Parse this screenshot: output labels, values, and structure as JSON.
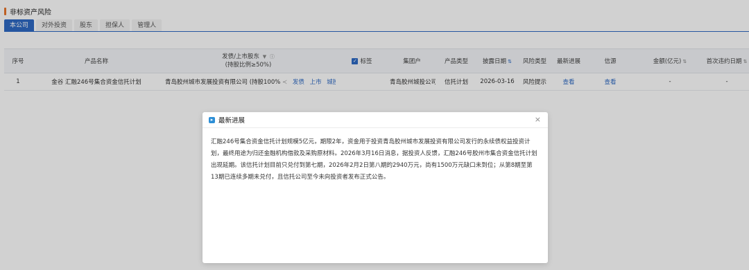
{
  "section": {
    "title": "非标资产风险"
  },
  "tabs": [
    "本公司",
    "对外投资",
    "股东",
    "担保人",
    "管理人"
  ],
  "table": {
    "headers": {
      "seq": "序号",
      "product_name": "产品名称",
      "issuer_line1": "发债/上市股东",
      "issuer_line2": "(持股比例≥50%)",
      "tag": "标签",
      "group": "集团户",
      "product_type": "产品类型",
      "disclose_date": "披露日期",
      "risk_type": "风险类型",
      "latest_progress": "最新进展",
      "source": "信源",
      "amount": "金额(亿元)",
      "first_default": "首次违约日期"
    },
    "rows": [
      {
        "seq": "1",
        "product_name": "金谷 汇融246号集合资金信托计划",
        "holder": "青岛胶州城市发展投资有限公司 (持股100%",
        "tag1": "发债",
        "tag2": "上市",
        "tag3": "城投",
        "group": "青岛胶州城投公司",
        "product_type": "信托计划",
        "disclose_date": "2026-03-16",
        "risk_type": "风险提示",
        "latest_progress": "查看",
        "source": "查看",
        "amount": "-",
        "first_default": "-"
      }
    ]
  },
  "modal": {
    "title": "最新进展",
    "close": "×",
    "body": "汇融246号集合资金信托计划规模5亿元，期限2年，资金用于投资青岛胶州城市发展投资有限公司发行的永续债权益投资计划，最终用途为归还金融机构借款及采购原材料。2026年3月16日消息，据投资人反馈，汇融246号胶州市集合资金信托计划出现延期。该信托计划目前只兑付到第七期，2026年2月2日第八期的2940万元，尚有1500万元缺口未到位；从第8期至第13期已连续多期未兑付，且信托公司至今未向投资者发布正式公告。"
  }
}
